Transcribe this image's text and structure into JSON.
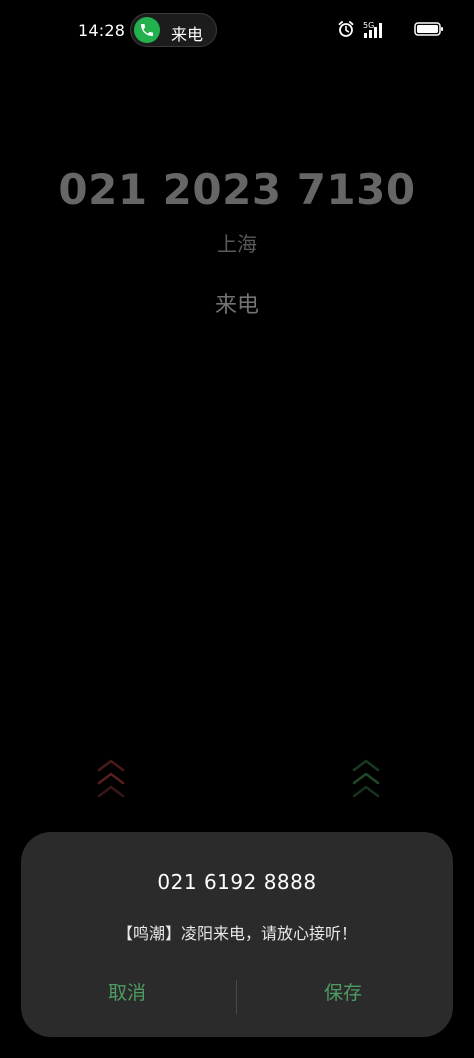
{
  "status_bar": {
    "time": "14:28",
    "call_pill_label": "来电",
    "network_label": "5G"
  },
  "caller": {
    "number": "021 2023 7130",
    "location": "上海",
    "state": "来电"
  },
  "card": {
    "number": "021 6192 8888",
    "message": "【鸣潮】凌阳来电，请放心接听！",
    "cancel_label": "取消",
    "save_label": "保存"
  },
  "colors": {
    "background": "#000000",
    "accent_green": "#22b14c",
    "button_green": "#4e9b62",
    "decline_arrow": "#5a1e1e",
    "accept_arrow": "#1e4a2a"
  },
  "icons": [
    "phone-icon",
    "alarm-icon",
    "signal-icon",
    "battery-icon",
    "swipe-up-decline-icon",
    "swipe-up-accept-icon"
  ]
}
